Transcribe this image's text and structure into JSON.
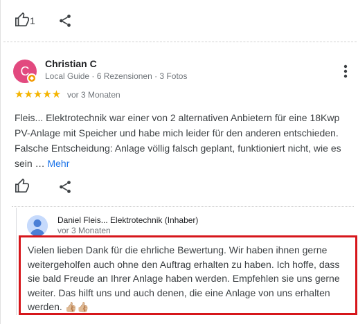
{
  "top_actions": {
    "like_count": "1"
  },
  "review": {
    "avatar_letter": "C",
    "author_name": "Christian C",
    "author_meta": "Local Guide · 6 Rezensionen · 3 Fotos",
    "stars": "★★★★★",
    "rating": 5,
    "time": "vor 3 Monaten",
    "text": "Fleis... Elektrotechnik war einer von 2 alternativen Anbietern für eine 18Kwp PV-Anlage mit Speicher und habe mich leider für den anderen entschieden. Falsche Entscheidung: Anlage völlig falsch geplant, funktioniert nicht, wie es sein … ",
    "more_label": "Mehr"
  },
  "owner_reply": {
    "name": "Daniel Fleis... Elektrotechnik (Inhaber)",
    "time": "vor 3 Monaten",
    "text": "Vielen lieben Dank für die ehrliche Bewertung. Wir haben ihnen gerne weitergeholfen auch ohne den Auftrag erhalten zu haben. Ich hoffe, dass sie bald Freude an Ihrer Anlage haben werden. Empfehlen sie uns gerne weiter. Das hilft uns und auch denen, die eine Anlage von uns erhalten werden. 👍🏼👍🏼"
  },
  "colors": {
    "avatar_bg": "#e2497f",
    "star": "#f4b400",
    "link": "#1a73e8",
    "highlight_border": "#d6161b"
  },
  "icons": [
    "thumbs-up-icon",
    "share-icon",
    "more-vert-icon",
    "local-guide-badge-icon"
  ]
}
